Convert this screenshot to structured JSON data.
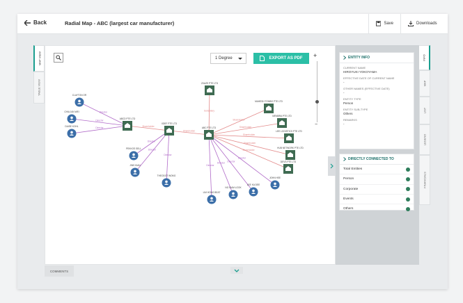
{
  "header": {
    "back_label": "Back",
    "title": "Radial Map - ABC (largest car manufacturer)",
    "save_label": "Save",
    "downloads_label": "Downloads"
  },
  "left_tabs": [
    "MAP VIEW",
    "TABLE VIEW"
  ],
  "toolbar": {
    "degree_value": "1 Degree",
    "export_label": "EXPORT AS PDF",
    "zoom_in": "+",
    "zoom_out": "−",
    "zoom_level": 0.35
  },
  "graph": {
    "nodes": [
      {
        "label": "CLAYTON OR",
        "type": "person"
      },
      {
        "label": "CHIA JAN WEI",
        "type": "person"
      },
      {
        "label": "DAISE KOHL",
        "type": "person"
      },
      {
        "label": "ABCD PTE LTD",
        "type": "corporate"
      },
      {
        "label": "XDEF PTE LTD",
        "type": "corporate"
      },
      {
        "label": "PEKKOS SELL",
        "type": "person"
      },
      {
        "label": "JINS KIAN",
        "type": "person"
      },
      {
        "label": "THEODOT WONG",
        "type": "person"
      },
      {
        "label": "ABC PTE LTD",
        "type": "corporate"
      },
      {
        "label": "ZXAZE PTE LTD",
        "type": "corporate"
      },
      {
        "label": "MAHESH TOMBO PTE LTD",
        "type": "corporate"
      },
      {
        "label": "MEMBRA PTE LTD",
        "type": "corporate"
      },
      {
        "label": "LEE LOGISTICS PTE LTD",
        "type": "corporate"
      },
      {
        "label": "HUB NETWORK PTE LTD",
        "type": "corporate"
      },
      {
        "label": "DEVS PTE LTD",
        "type": "corporate"
      },
      {
        "label": "JOHN HEE",
        "type": "person"
      },
      {
        "label": "LEE KA DEE",
        "type": "person"
      },
      {
        "label": "NG SIAM LOOK",
        "type": "person"
      },
      {
        "label": "LIM HONG BEAT",
        "type": "person"
      }
    ],
    "edges": [
      {
        "label": "Director"
      },
      {
        "label": "Director"
      },
      {
        "label": "Director"
      },
      {
        "label": "Shareholder"
      },
      {
        "label": "Shareholder"
      },
      {
        "label": "Director"
      },
      {
        "label": "Director"
      },
      {
        "label": "Director"
      },
      {
        "label": "Subsidiary"
      },
      {
        "label": "Shareholder"
      },
      {
        "label": "Shareholder"
      },
      {
        "label": "Shareholder"
      },
      {
        "label": "Shareholder"
      },
      {
        "label": "Shareholder"
      },
      {
        "label": "Director"
      },
      {
        "label": "Director"
      },
      {
        "label": "Director"
      },
      {
        "label": "Director"
      }
    ]
  },
  "comments_label": "COMMENTS",
  "entity_info": {
    "header": "ENTITY INFO",
    "fields": [
      {
        "label": "CURRENT NAME",
        "value": "HIROYUKI YOKOYAMA"
      },
      {
        "label": "EFFECTIVE DATE OF CURRENT NAME",
        "value": "-"
      },
      {
        "label": "OTHER NAMES (EFFECTIVE DATE)",
        "value": "-"
      },
      {
        "label": "ENTITY TYPE",
        "value": "Person"
      },
      {
        "label": "ENTITY SUB-TYPE",
        "value": "Others"
      },
      {
        "label": "REMARKS",
        "value": "-"
      }
    ]
  },
  "directly_connected": {
    "header": "DIRECTLY CONNECTED TO",
    "rows": [
      "Total Entities",
      "Person",
      "Corporate",
      "Events",
      "Others"
    ]
  },
  "right_tabs": [
    "INFO",
    "MAP",
    "LIST",
    "LEGEND",
    "FINANCIALS"
  ],
  "colors": {
    "accent": "#2bbfa6",
    "node": "#3f6b52",
    "person": "#3b6ea8",
    "shareholder_edge": "#e38a8a",
    "director_edge": "#b06ac8"
  }
}
